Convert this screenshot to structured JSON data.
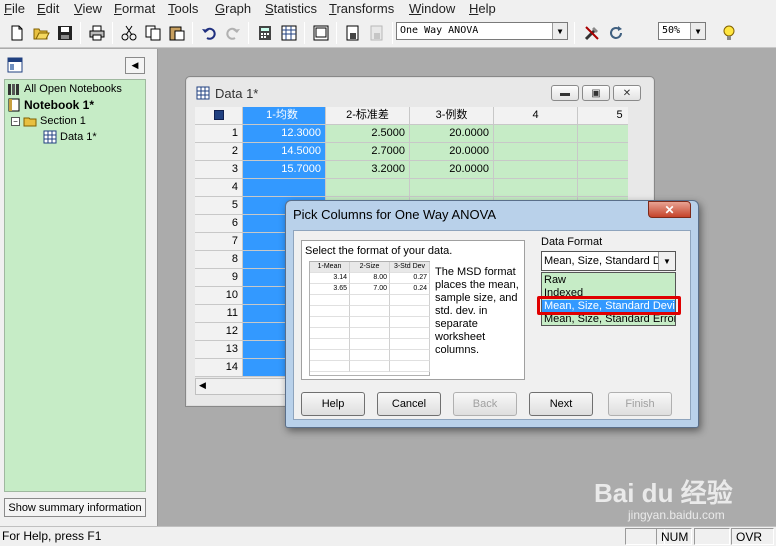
{
  "menu": [
    "File",
    "Edit",
    "View",
    "Format",
    "Tools",
    "Graph",
    "Statistics",
    "Transforms",
    "Window",
    "Help"
  ],
  "toolbar": {
    "test_combo": "One Way ANOVA",
    "zoom": "50%"
  },
  "tree": {
    "root": "All Open Notebooks",
    "notebook": "Notebook 1*",
    "section": "Section 1",
    "worksheet": "Data 1*"
  },
  "summary_button": "Show summary information",
  "status": {
    "help": "For Help, press F1",
    "num": "NUM",
    "ovr": "OVR"
  },
  "datawin": {
    "title": "Data 1*",
    "columns": [
      "1-均数",
      "2-标准差",
      "3-例数",
      "4",
      "5"
    ],
    "rows": [
      [
        "12.3000",
        "2.5000",
        "20.0000",
        "",
        ""
      ],
      [
        "14.5000",
        "2.7000",
        "20.0000",
        "",
        ""
      ],
      [
        "15.7000",
        "3.2000",
        "20.0000",
        "",
        ""
      ]
    ],
    "row_numbers": [
      "1",
      "2",
      "3",
      "4",
      "5",
      "6",
      "7",
      "8",
      "9",
      "10",
      "11",
      "12",
      "13",
      "14"
    ]
  },
  "dialog": {
    "title": "Pick Columns for One Way ANOVA",
    "prompt": "Select the format of your data.",
    "mini_headers": [
      "1-Mean",
      "2-Size",
      "3-Std Dev"
    ],
    "mini_rows": [
      [
        "3.14",
        "8.00",
        "0.27"
      ],
      [
        "3.65",
        "7.00",
        "0.24"
      ]
    ],
    "description": "The MSD format places the mean, sample size, and std. dev. in separate worksheet columns.",
    "format_label": "Data Format",
    "format_selected": "Mean, Size, Standard Deviation",
    "format_options": [
      "Raw",
      "Indexed",
      "Mean, Size, Standard Deviation",
      "Mean, Size, Standard Error"
    ],
    "buttons": {
      "help": "Help",
      "cancel": "Cancel",
      "back": "Back",
      "next": "Next",
      "finish": "Finish"
    }
  },
  "watermark": {
    "logo": "Bai du 经验",
    "url": "jingyan.baidu.com"
  },
  "colors": {
    "selected_column": "#3399ff",
    "green_cells": "#c6ecc6",
    "highlight_box": "#e00000"
  }
}
